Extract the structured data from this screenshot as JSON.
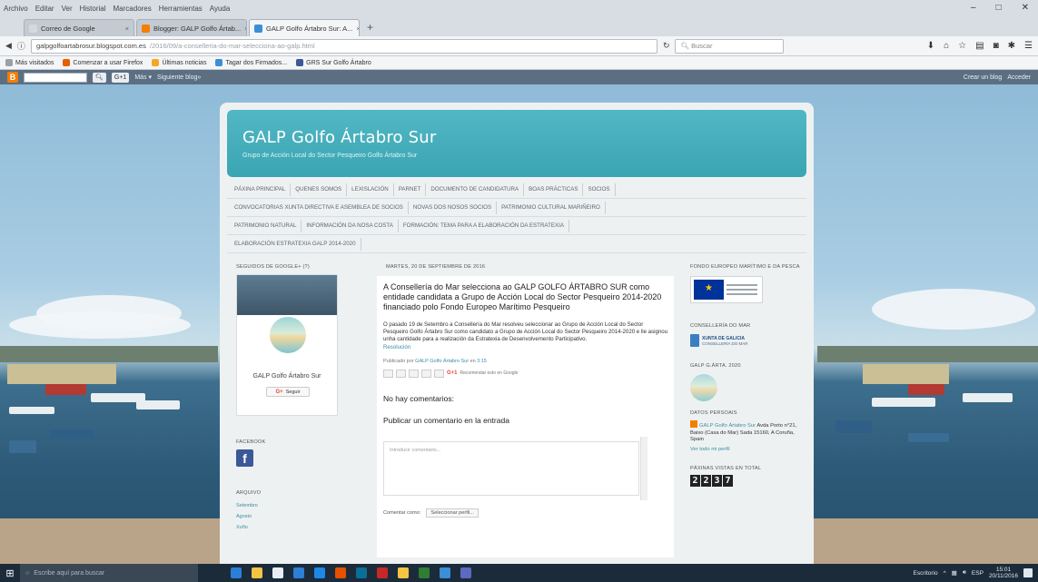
{
  "browser": {
    "menu": [
      "Archivo",
      "Editar",
      "Ver",
      "Historial",
      "Marcadores",
      "Herramientas",
      "Ayuda"
    ],
    "tabs": [
      {
        "label": "Correo de Google",
        "fav_color": "#d5d9de"
      },
      {
        "label": "Blogger: GALP Golfo Ártab...",
        "fav_color": "#f57d00"
      },
      {
        "label": "GALP Golfo Ártabro Sur: A...",
        "fav_color": "#3a8fd6"
      }
    ],
    "url": "galpgolfoartabrosur.blogspot.com.es",
    "url_rest": "/2016/09/a-conselleria-do-mar-selecciona-ao-galp.html",
    "search_placeholder": "Buscar",
    "bookmarks": [
      {
        "label": "Más visitados",
        "color": "#9aa0a6"
      },
      {
        "label": "Comenzar a usar Firefox",
        "color": "#e66000"
      },
      {
        "label": "Últimas noticias",
        "color": "#f5a623"
      },
      {
        "label": "Tagar dos Firmados...",
        "color": "#3a8fd6"
      },
      {
        "label": "GRS Sur Golfo Ártabro",
        "color": "#3b5998"
      }
    ]
  },
  "blogger_bar": {
    "logo": "B",
    "go_label": "G+1",
    "more_label": "Más ▾",
    "next_label": "Siguiente blog»",
    "create_label": "Crear un blog",
    "login_label": "Acceder"
  },
  "blog": {
    "title": "GALP Golfo Ártabro Sur",
    "description": "Grupo de Acción Local do Sector Pesqueiro Golfo Ártabro Sur",
    "pages_rows": [
      [
        "PÁXINA PRINCIPAL",
        "QUENES SOMOS",
        "LEXISLACIÓN",
        "PARNET",
        "DOCUMENTO DE CANDIDATURA",
        "BOAS PRÁCTICAS",
        "SOCIOS"
      ],
      [
        "CONVOCATORIAS XUNTA DIRECTIVA E ASEMBLEA DE SOCIOS",
        "NOVAS DOS NOSOS SOCIOS",
        "PATRIMONIO CULTURAL MARIÑEIRO"
      ],
      [
        "PATRIMONIO NATURAL",
        "INFORMACIÓN DA NOSA COSTA",
        "FORMACIÓN: TEMA PARA A ELABORACIÓN DA ESTRATEXIA"
      ],
      [
        "ELABORACIÓN ESTRATEXIA GALP 2014-2020"
      ]
    ]
  },
  "left": {
    "followers_title": "SEGUIDOS DE GOOGLE+ (?)",
    "profile_name": "GALP Golfo Ártabro Sur",
    "follow_gplus": "G+",
    "follow_label": "Seguir",
    "facebook_title": "FACEBOOK",
    "facebook_icon": "f",
    "archive_title": "ARQUIVO",
    "archive": [
      "Setembro",
      "Agosto",
      "Xuño"
    ]
  },
  "post": {
    "date": "MARTES, 20 DE SEPTIEMBRE DE 2016",
    "title": "A Consellería do Mar selecciona ao GALP GOLFO ÁRTABRO SUR como entidade candidata a Grupo de Acción Local do Sector Pesqueiro 2014-2020 financiado polo Fondo Europeo Marítimo Pesqueiro",
    "body": "O pasado 19 de Setembro a Consellería do Mar resolveu seleccionar ao Grupo de Acción Local do Sector Pesqueiro Golfo Ártabro Sur como candidato a Grupo de Acción Local do Sector Pesqueiro 2014-2020 e lle asignou unha cantidade para a realización da Estratexia de Desenvolvemento Participativo.",
    "body_link": "Resolución",
    "meta_prefix": "Publicado por",
    "meta_author": "GALP Golfo Ártabro Sur",
    "meta_en": "en",
    "meta_time": "3:15",
    "share_note": "Recomendar esto en Google",
    "share_gp": "G+1",
    "no_comments": "No hay comentarios:",
    "publish_comment": "Publicar un comentario en la entrada",
    "comment_placeholder": "Introducir comentario...",
    "comment_as_label": "Comentar como:",
    "comment_as_value": "Seleccionar perfil..."
  },
  "right": {
    "eu_title": "FONDO EUROPEO MARÍTIMO E DA PESCA",
    "xunta_title": "CONSELLERÍA DO MAR",
    "xunta_name": "XUNTA DE GALICIA",
    "xunta_sub": "CONSELLERÍA DO MAR",
    "galp_title": "GALP G.ÁRTA. 2020",
    "profile_title": "DATOS PERSOAIS",
    "profile_name": "GALP Golfo Ártabro Sur",
    "profile_address": "Avda Porto n°21, Baixo (Casa do Mar) Sada 15160, A Coruña, Spain",
    "profile_link": "Ver todo mi perfil",
    "visits_title": "PÁXINAS VISTAS EN TOTAL",
    "visits_digits": [
      "2",
      "2",
      "3",
      "7"
    ]
  },
  "taskbar": {
    "search_placeholder": "Escribe aquí para buscar",
    "apps": [
      "#2b7fd6",
      "#f5c542",
      "#e8eef3",
      "#2b7fd6",
      "#1e88e5",
      "#e65100",
      "#0b6e99",
      "#c62828",
      "#f5c542",
      "#2e7d32",
      "#3a8fd6",
      "#5c6bc0"
    ],
    "tray_text": "Escritorio",
    "lang": "ESP",
    "time": "15:01",
    "date": "20/11/2016"
  }
}
